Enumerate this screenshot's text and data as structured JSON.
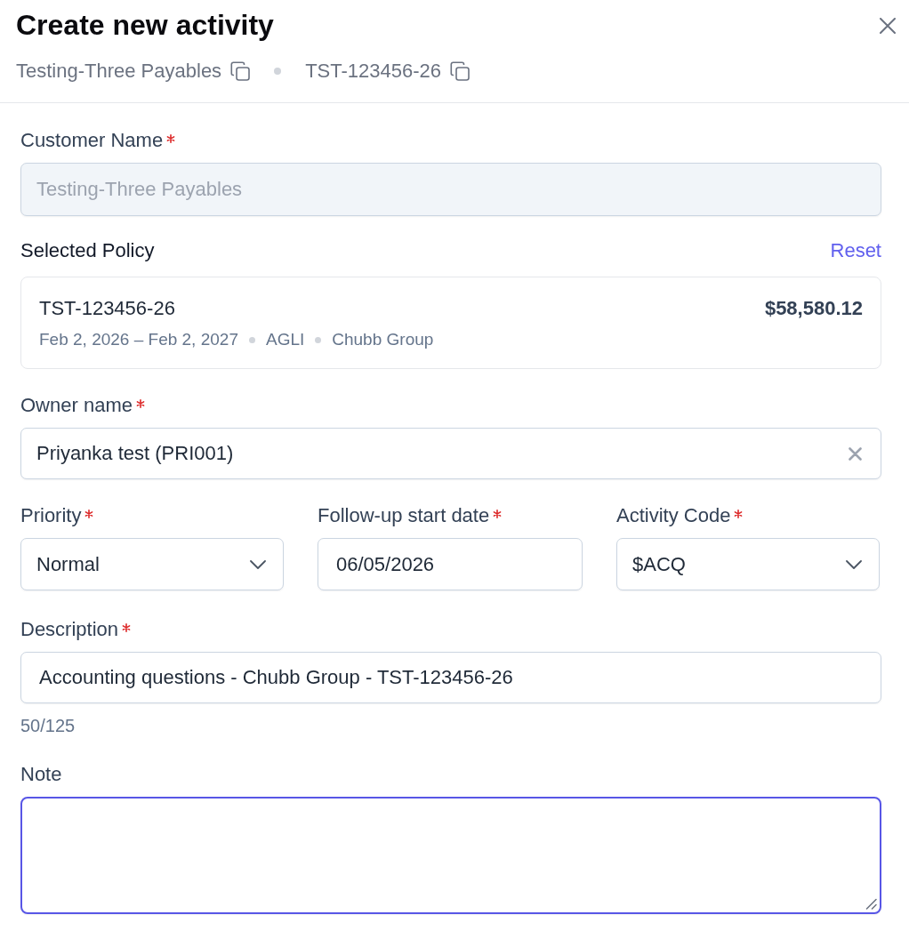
{
  "header": {
    "title": "Create new activity",
    "meta": [
      "Testing-Three Payables",
      "TST-123456-26"
    ]
  },
  "customer_name": {
    "label": "Customer Name",
    "required": true,
    "value": "Testing-Three Payables",
    "disabled": true
  },
  "selected_policy": {
    "label": "Selected Policy",
    "reset": "Reset",
    "policy_number": "TST-123456-26",
    "premium": "$58,580.12",
    "details": [
      "Feb 2, 2026 – Feb 2, 2027",
      "AGLI",
      "Chubb Group"
    ]
  },
  "owner_name": {
    "label": "Owner name",
    "required": true,
    "value": "Priyanka test (PRI001)",
    "clearable": true
  },
  "fields_row": [
    {
      "kind": "select",
      "label": "Priority",
      "required": true,
      "value": "Normal"
    },
    {
      "kind": "date",
      "label": "Follow-up start date",
      "required": true,
      "value": "06/05/2026"
    },
    {
      "kind": "select",
      "label": "Activity Code",
      "required": true,
      "value": "$ACQ"
    }
  ],
  "description": {
    "label": "Description",
    "required": true,
    "value": "Accounting questions - Chubb Group - TST-123456-26",
    "counter": "50/125"
  },
  "note": {
    "label": "Note",
    "required": false,
    "focused": true
  }
}
